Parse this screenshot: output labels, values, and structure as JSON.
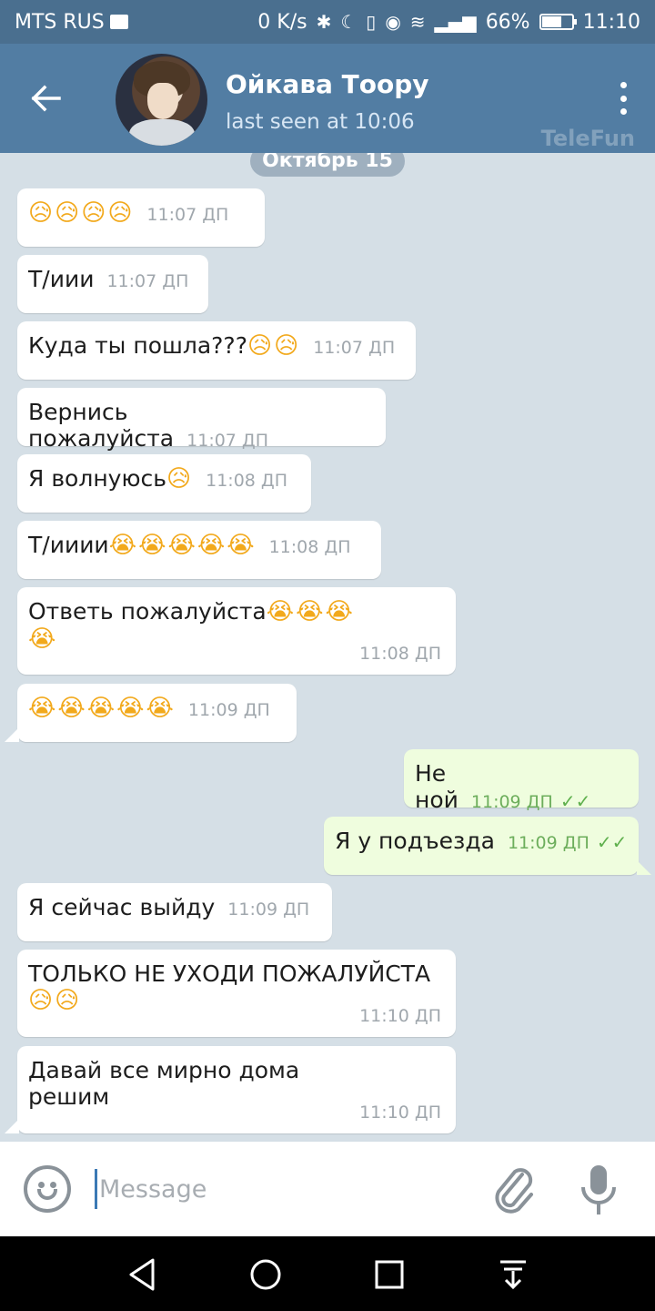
{
  "status_bar": {
    "carrier": "MTS RUS",
    "speed": "0 K/s",
    "battery": "66%",
    "battery_level": 0.66,
    "time": "11:10"
  },
  "header": {
    "name": "Ойкава  Тоору",
    "status": "last seen at 10:06",
    "watermark": "TeleFun"
  },
  "chat": {
    "date": "Октябрь 15",
    "messages": [
      {
        "dir": "in",
        "text": "",
        "emoji": "😥😥😥😥",
        "time": "11:07 ДП"
      },
      {
        "dir": "in",
        "text": "Т/иии",
        "emoji": "",
        "time": "11:07 ДП"
      },
      {
        "dir": "in",
        "text": "Куда ты пошла???",
        "emoji": "😥😥",
        "time": "11:07 ДП"
      },
      {
        "dir": "in",
        "text": "Вернись пожалуйста",
        "emoji": "",
        "time": "11:07 ДП"
      },
      {
        "dir": "in",
        "text": "Я волнуюсь",
        "emoji": "😥",
        "time": "11:08 ДП"
      },
      {
        "dir": "in",
        "text": "Т/ииии",
        "emoji": "😭😭😭😭😭",
        "time": "11:08 ДП"
      },
      {
        "dir": "in",
        "text": "Ответь пожалуйста",
        "emoji": "😭😭😭",
        "emoji2": "😭",
        "time": "11:08 ДП"
      },
      {
        "dir": "in",
        "text": "",
        "emoji": "😭😭😭😭😭",
        "time": "11:09 ДП"
      },
      {
        "dir": "out",
        "text": "Не ной",
        "time": "11:09 ДП"
      },
      {
        "dir": "out",
        "text": "Я у подъезда",
        "time": "11:09 ДП"
      },
      {
        "dir": "in",
        "text": "Я сейчас выйду",
        "time": "11:09 ДП"
      },
      {
        "dir": "in",
        "text": "ТОЛЬКО НЕ УХОДИ ПОЖАЛУЙСТА",
        "emoji2": "😥😥",
        "time": "11:10 ДП"
      },
      {
        "dir": "in",
        "text": "Давай все мирно дома",
        "text2": "решим",
        "time": "11:10 ДП"
      }
    ]
  },
  "input": {
    "placeholder": "Message",
    "value": ""
  },
  "icons": {
    "back": "arrow-left-icon",
    "menu": "more-vertical-icon",
    "emoji": "smiley-icon",
    "attach": "paperclip-icon",
    "mic": "microphone-icon",
    "read_receipt": "double-check-icon"
  },
  "colors": {
    "header": "#527da3",
    "chat_bg": "#d5dfe6",
    "incoming": "#ffffff",
    "outgoing": "#effdde",
    "check": "#5fb04d"
  }
}
